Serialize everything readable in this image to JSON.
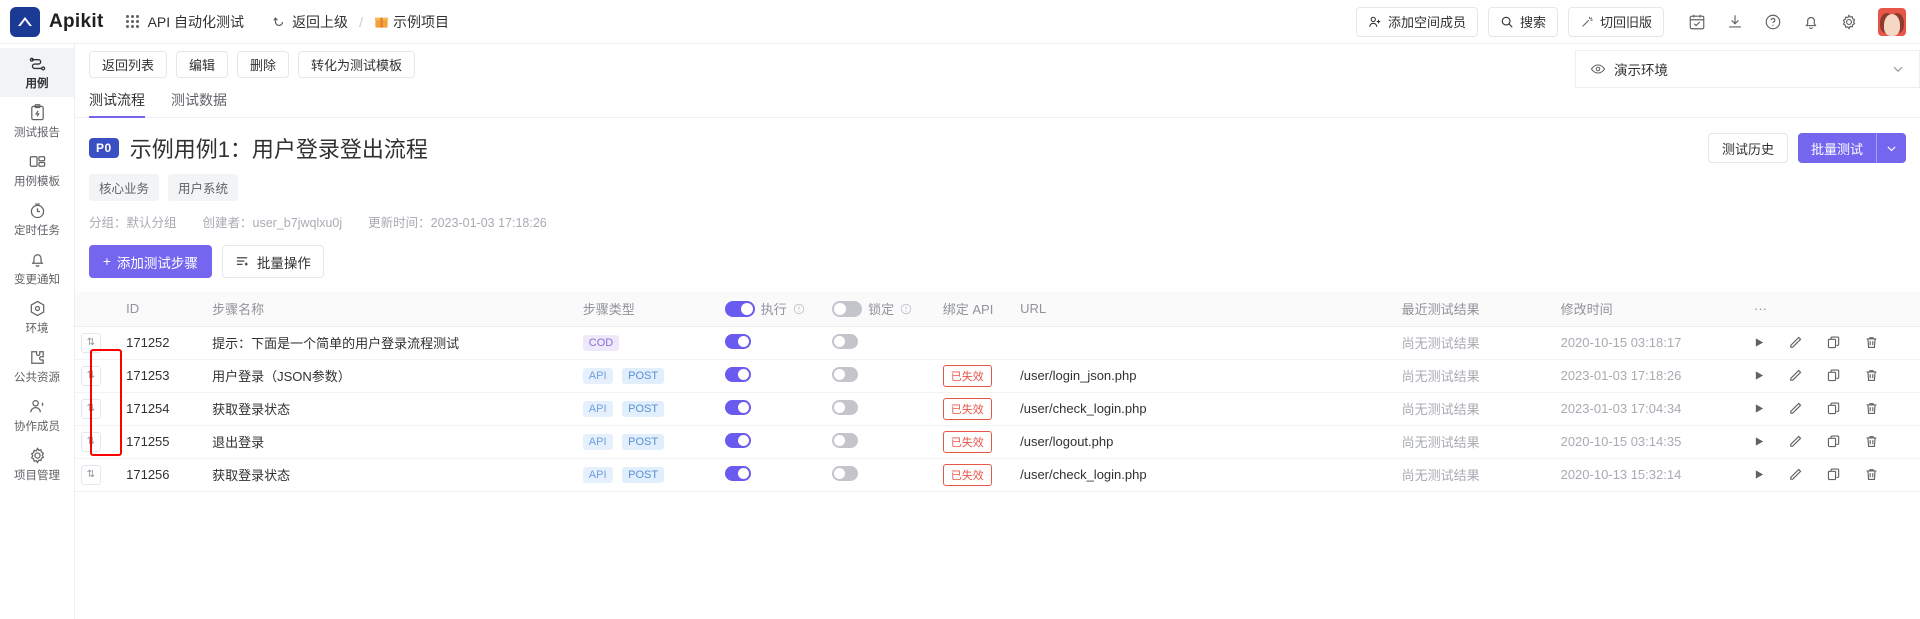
{
  "topbar": {
    "brand": "Apikit",
    "workspace": "API 自动化测试",
    "back_label": "返回上级",
    "separator": "/",
    "project": "示例项目",
    "add_member": "添加空间成员",
    "search": "搜索",
    "switch_legacy": "切回旧版",
    "icons": [
      "calendar-icon",
      "download-icon",
      "help-icon",
      "bell-icon",
      "gear-icon"
    ]
  },
  "sidebar": {
    "items": [
      {
        "label": "用例",
        "icon": "flow-icon",
        "active": true
      },
      {
        "label": "测试报告",
        "icon": "report-icon",
        "active": false
      },
      {
        "label": "用例模板",
        "icon": "template-icon",
        "active": false
      },
      {
        "label": "定时任务",
        "icon": "timer-icon",
        "active": false
      },
      {
        "label": "变更通知",
        "icon": "bell-icon",
        "active": false
      },
      {
        "label": "环境",
        "icon": "cube-icon",
        "active": false
      },
      {
        "label": "公共资源",
        "icon": "puzzle-icon",
        "active": false
      },
      {
        "label": "协作成员",
        "icon": "users-icon",
        "active": false
      },
      {
        "label": "项目管理",
        "icon": "gear-icon",
        "active": false
      }
    ]
  },
  "toolbar": {
    "back_list": "返回列表",
    "edit": "编辑",
    "delete": "删除",
    "convert_template": "转化为测试模板"
  },
  "environment": {
    "label": "演示环境",
    "icon": "eye-icon"
  },
  "tabs": [
    {
      "label": "测试流程",
      "active": true
    },
    {
      "label": "测试数据",
      "active": false
    }
  ],
  "case": {
    "priority": "P0",
    "title": "示例用例1：用户登录登出流程",
    "tags": [
      "核心业务",
      "用户系统"
    ],
    "meta": {
      "group": "分组：默认分组",
      "creator": "创建者：user_b7jwqlxu0j",
      "updated": "更新时间：2023-01-03 17:18:26"
    },
    "test_history": "测试历史",
    "batch_test": "批量测试"
  },
  "actions": {
    "add_step": "添加测试步骤",
    "add_step_plus": "+",
    "bulk_ops": "批量操作"
  },
  "table": {
    "columns": [
      {
        "key": "handle",
        "label": ""
      },
      {
        "key": "id",
        "label": "ID"
      },
      {
        "key": "name",
        "label": "步骤名称"
      },
      {
        "key": "type",
        "label": "步骤类型"
      },
      {
        "key": "exec",
        "label": "执行"
      },
      {
        "key": "lock",
        "label": "锁定"
      },
      {
        "key": "bind",
        "label": "绑定 API"
      },
      {
        "key": "url",
        "label": "URL"
      },
      {
        "key": "result",
        "label": "最近测试结果"
      },
      {
        "key": "time",
        "label": "修改时间"
      },
      {
        "key": "more",
        "label": "···"
      }
    ],
    "header_exec_toggle": "on",
    "header_lock_toggle": "off",
    "rows": [
      {
        "id": "171252",
        "name": "提示：下面是一个简单的用户登录流程测试",
        "types": [
          "COD"
        ],
        "exec": "on",
        "lock": "off",
        "bind": "",
        "url": "",
        "result": "尚无测试结果",
        "time": "2020-10-15 03:18:17"
      },
      {
        "id": "171253",
        "name": "用户登录（JSON参数）",
        "types": [
          "API",
          "POST"
        ],
        "exec": "on",
        "lock": "off",
        "bind": "已失效",
        "url": "/user/login_json.php",
        "result": "尚无测试结果",
        "time": "2023-01-03 17:18:26"
      },
      {
        "id": "171254",
        "name": "获取登录状态",
        "types": [
          "API",
          "POST"
        ],
        "exec": "on",
        "lock": "off",
        "bind": "已失效",
        "url": "/user/check_login.php",
        "result": "尚无测试结果",
        "time": "2023-01-03 17:04:34"
      },
      {
        "id": "171255",
        "name": "退出登录",
        "types": [
          "API",
          "POST"
        ],
        "exec": "on",
        "lock": "off",
        "bind": "已失效",
        "url": "/user/logout.php",
        "result": "尚无测试结果",
        "time": "2020-10-15 03:14:35"
      },
      {
        "id": "171256",
        "name": "获取登录状态",
        "types": [
          "API",
          "POST"
        ],
        "exec": "on",
        "lock": "off",
        "bind": "已失效",
        "url": "/user/check_login.php",
        "result": "尚无测试结果",
        "time": "2020-10-13 15:32:14"
      }
    ],
    "row_actions": [
      "run-icon",
      "edit-icon",
      "copy-icon",
      "delete-icon"
    ]
  },
  "colors": {
    "accent": "#7566f0",
    "badge": "#3b4fc4",
    "danger": "#e8564a",
    "annotation": "#ff0000"
  }
}
